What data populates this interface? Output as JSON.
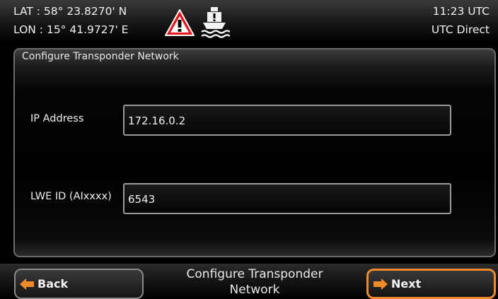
{
  "header": {
    "lat": "LAT  : 58° 23.8270' N",
    "lon": "LON : 15° 41.9727' E",
    "time": "11:23 UTC",
    "time_source": "UTC Direct",
    "icons": [
      "warning-triangle-icon",
      "ship-alert-icon"
    ],
    "warning_color": "#e3161b"
  },
  "panel": {
    "title": "Configure Transponder Network",
    "ip_label": "IP Address",
    "ip_value": "172.16.0.2",
    "lwe_label": "LWE ID (AIxxxx)",
    "lwe_value": "6543"
  },
  "footer": {
    "back_label": "Back",
    "next_label": "Next",
    "title_line1": "Configure Transponder",
    "title_line2": "Network",
    "accent_color": "#f08a2a"
  }
}
